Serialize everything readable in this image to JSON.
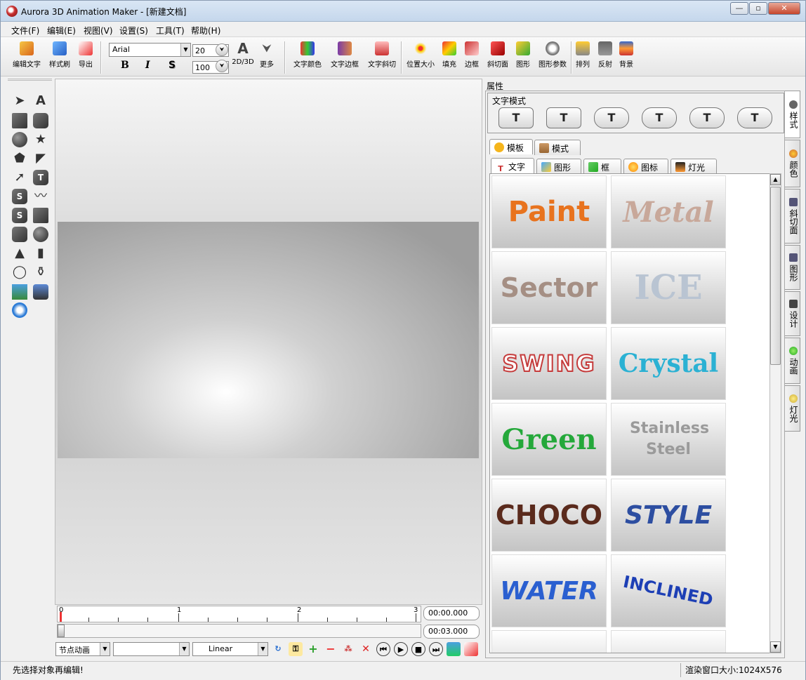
{
  "window": {
    "title": "Aurora 3D Animation Maker - [新建文档]"
  },
  "menu": [
    "文件(F)",
    "编辑(E)",
    "视图(V)",
    "设置(S)",
    "工具(T)",
    "帮助(H)"
  ],
  "toolbar": {
    "edit_text": "编辑文字",
    "style_brush": "样式刷",
    "export": "导出",
    "font": "Arial",
    "font_size": "20",
    "depth": "100",
    "bold": "B",
    "italic": "I",
    "shadow": "S",
    "mode_2d3d": "2D/3D",
    "more": "更多",
    "text_color": "文字颜色",
    "text_border": "文字边框",
    "text_bevel": "文字斜切",
    "position_size": "位置大小",
    "fill": "填充",
    "border": "边框",
    "bevel": "斜切面",
    "shape": "图形",
    "shape_params": "图形参数",
    "arrange": "排列",
    "reflect": "反射",
    "background": "背景"
  },
  "properties": {
    "title": "属性",
    "text_mode_label": "文字模式",
    "text_mode_buttons": [
      "T",
      "T",
      "T",
      "T",
      "T",
      "T"
    ],
    "tabs_top": [
      "模板",
      "模式"
    ],
    "tabs_sub": [
      "文字",
      "图形",
      "框",
      "图标",
      "灯光"
    ],
    "templates": [
      {
        "text": "Paint",
        "color": "#e8731e"
      },
      {
        "text": "Metal",
        "color": "#c8a89a"
      },
      {
        "text": "Sector",
        "color": "#a58f84"
      },
      {
        "text": "ICE",
        "color": "#b9c4d2"
      },
      {
        "text": "SWING",
        "color": "#c53b3b"
      },
      {
        "text": "Crystal",
        "color": "#2bb1d3"
      },
      {
        "text": "Green",
        "color": "#24a83a"
      },
      {
        "text": "Stainless Steel",
        "color": "#9a9a9a"
      },
      {
        "text": "CHOCO",
        "color": "#5a2a1c"
      },
      {
        "text": "STYLE",
        "color": "#2d4ea1"
      },
      {
        "text": "WATER",
        "color": "#2a5fd0"
      },
      {
        "text": "INCLINED",
        "color": "#1d3fb5"
      }
    ],
    "side_tabs": [
      "样式",
      "颜色",
      "斜切面",
      "图形",
      "设计",
      "动画",
      "灯光"
    ]
  },
  "timeline": {
    "ruler_labels": [
      "0",
      "1",
      "2",
      "3"
    ],
    "current_time": "00:00.000",
    "total_time": "00:03.000",
    "animation_type": "节点动画",
    "object_select": "",
    "interpolation": "Linear",
    "progress": 0
  },
  "status": {
    "message": "先选择对象再编辑!",
    "render_size": "渲染窗口大小:1024X576"
  }
}
